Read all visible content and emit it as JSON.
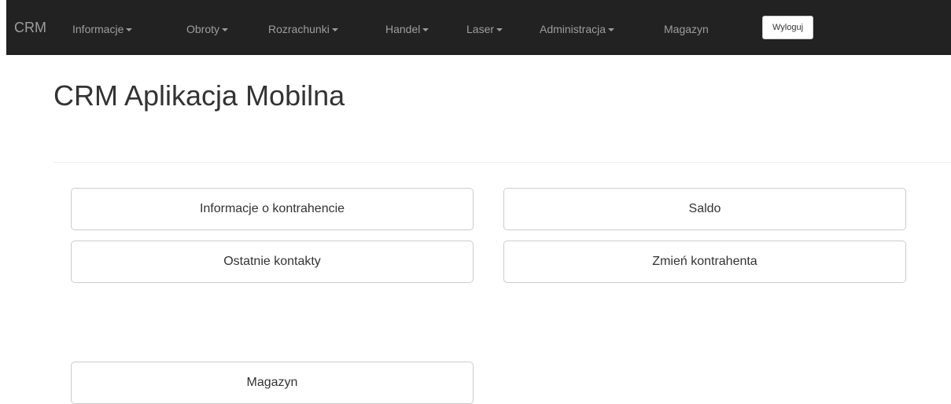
{
  "navbar": {
    "brand": "CRM",
    "items": [
      {
        "label": "Informacje",
        "dropdown": true
      },
      {
        "label": "Obroty",
        "dropdown": true
      },
      {
        "label": "Rozrachunki",
        "dropdown": true
      },
      {
        "label": "Handel",
        "dropdown": true
      },
      {
        "label": "Laser",
        "dropdown": true
      },
      {
        "label": "Administracja",
        "dropdown": true
      },
      {
        "label": "Magazyn",
        "dropdown": false
      }
    ],
    "logout_label": "Wyloguj"
  },
  "main": {
    "title": "CRM Aplikacja Mobilna",
    "buttons": {
      "customer_info": "Informacje o kontrahencie",
      "balance": "Saldo",
      "recent_contacts": "Ostatnie kontakty",
      "change_customer": "Zmień kontrahenta",
      "warehouse": "Magazyn"
    }
  },
  "colors": {
    "navbar_bg": "#222222",
    "navbar_text": "#9d9d9d",
    "button_border": "#cccccc",
    "text": "#333333"
  }
}
